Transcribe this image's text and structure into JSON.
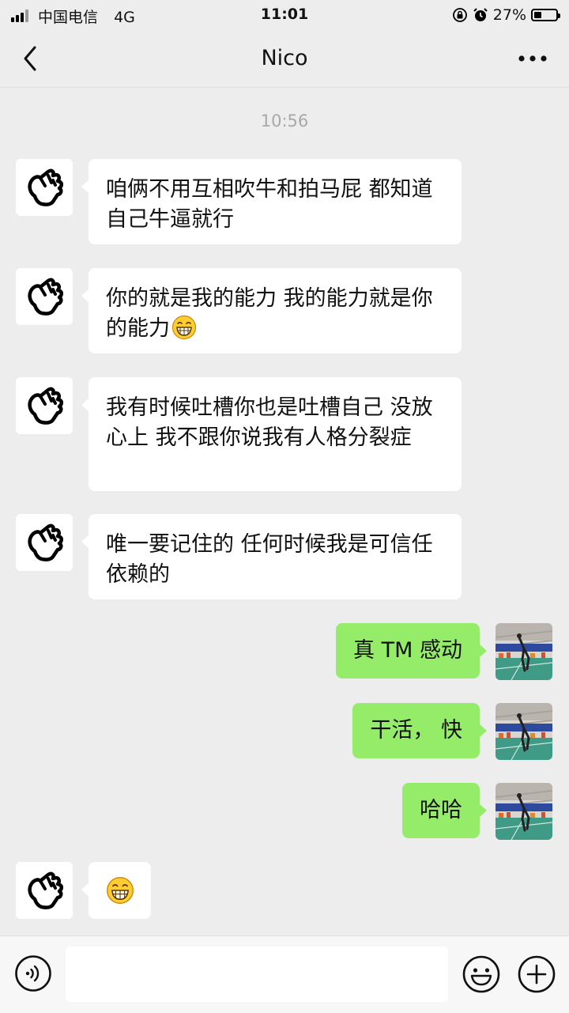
{
  "status_bar": {
    "carrier": "中国电信",
    "network": "4G",
    "time": "11:01",
    "battery": "27%",
    "battery_level": 0.27
  },
  "header": {
    "title": "Nico"
  },
  "chat": {
    "timestamp": "10:56",
    "messages": [
      {
        "side": "left",
        "text": "咱俩不用互相吹牛和拍马屁 都知道自己牛逼就行"
      },
      {
        "side": "left",
        "text": "你的就是我的能力 我的能力就是你的能力",
        "emoji": "grinning-face-emoji"
      },
      {
        "side": "left",
        "text": "我有时候吐槽你也是吐槽自己 没放心上 我不跟你说我有人格分裂症"
      },
      {
        "side": "left",
        "text": "唯一要记住的 任何时候我是可信任依赖的"
      },
      {
        "side": "right",
        "text": "真 TM 感动"
      },
      {
        "side": "right",
        "text": "干活， 快"
      },
      {
        "side": "right",
        "text": "哈哈"
      },
      {
        "side": "left",
        "text": "",
        "emoji": "grinning-face-emoji"
      }
    ]
  },
  "input_bar": {
    "placeholder": "",
    "icons": [
      "voice-icon",
      "emoji-icon",
      "plus-icon"
    ]
  },
  "colors": {
    "background": "#ededed",
    "outgoing_bubble": "#95ec69",
    "incoming_bubble": "#ffffff",
    "timestamp": "#a8a8a8"
  }
}
